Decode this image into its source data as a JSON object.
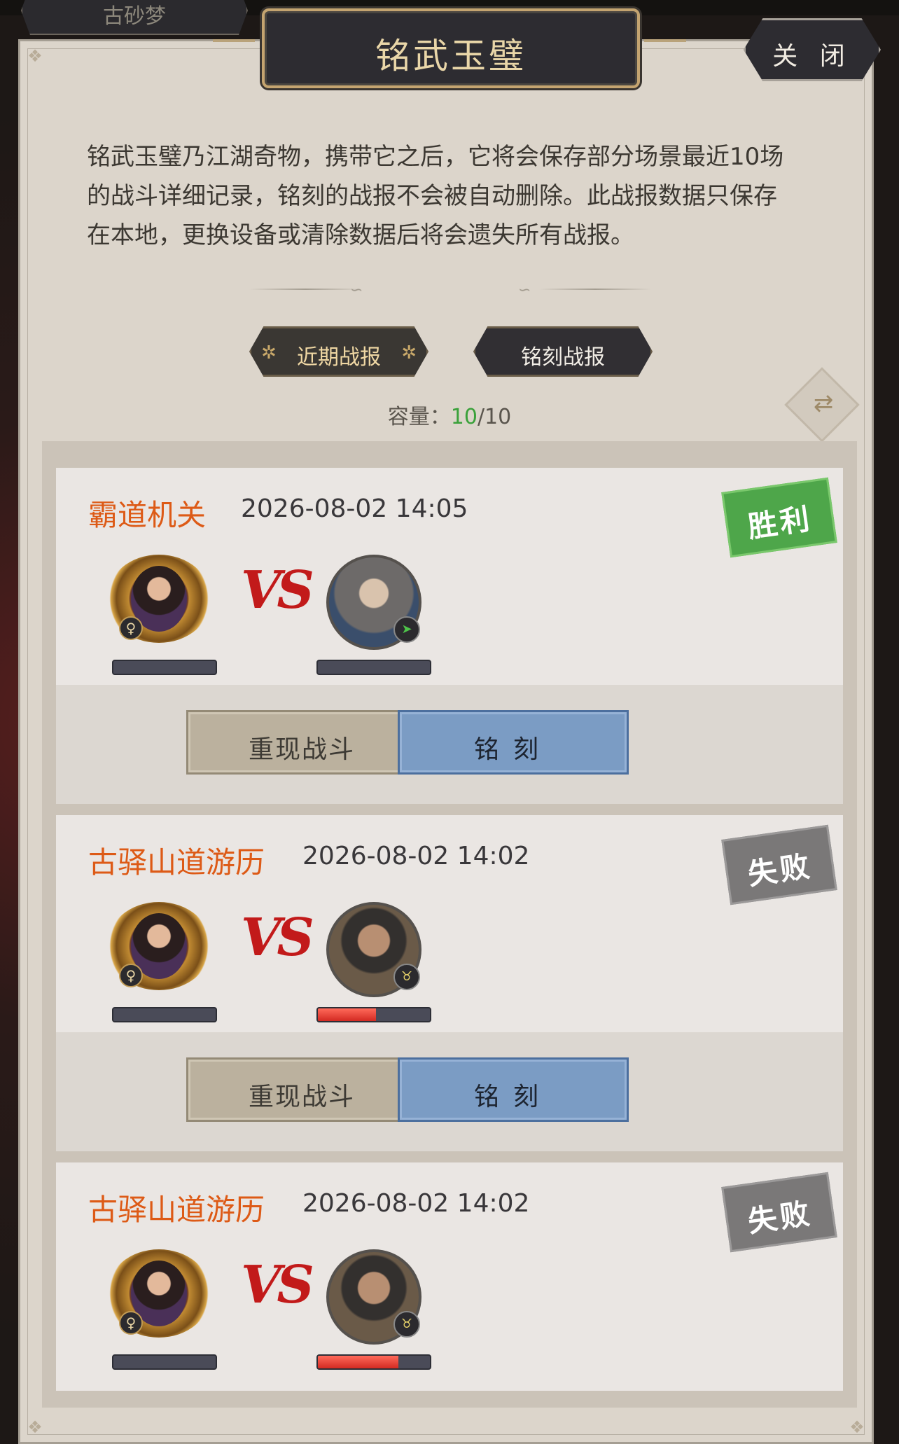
{
  "top_tab": {
    "label": "古砂梦"
  },
  "header": {
    "title": "铭武玉璧",
    "close_label": "关 闭"
  },
  "description": "铭武玉璧乃江湖奇物，携带它之后，它将会保存部分场景最近10场的战斗详细记录，铭刻的战报不会被自动删除。此战报数据只保存在本地，更换设备或清除数据后将会遗失所有战报。",
  "tabs": [
    {
      "label": "近期战报",
      "selected": true
    },
    {
      "label": "铭刻战报",
      "selected": false
    }
  ],
  "capacity": {
    "label": "容量：",
    "used": "10",
    "total": "/10"
  },
  "records": [
    {
      "name": "霸道机关",
      "time": "2026-08-02 14:05",
      "result": "胜利",
      "player_hp": 0,
      "enemy_hp": 0,
      "enemy_badge": "green-leaf",
      "replay_label": "重现战斗",
      "engrave_label": "铭刻"
    },
    {
      "name": "古驿山道游历",
      "time": "2026-08-02 14:02",
      "result": "失败",
      "player_hp": 0,
      "enemy_hp": 0.52,
      "enemy_badge": "gold-horn",
      "replay_label": "重现战斗",
      "engrave_label": "铭刻"
    },
    {
      "name": "古驿山道游历",
      "time": "2026-08-02 14:02",
      "result": "失败",
      "player_hp": 0,
      "enemy_hp": 0.72,
      "enemy_badge": "gold-horn"
    }
  ],
  "vs_text": "VS",
  "gender_symbol": "♀",
  "colors": {
    "win": "#4ea64a",
    "lose": "#7a7878",
    "name": "#dd5a16",
    "capacity_used": "#3aa13a",
    "hp": "#e03a2e"
  }
}
